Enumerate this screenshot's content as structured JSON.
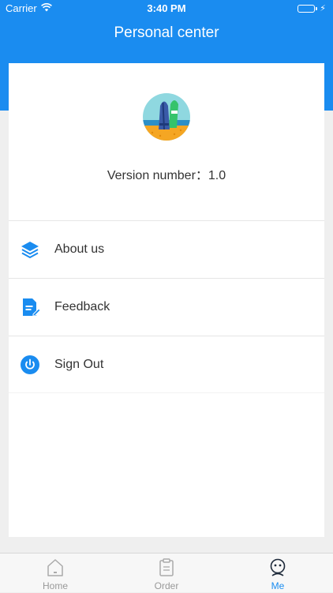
{
  "status_bar": {
    "carrier": "Carrier",
    "time": "3:40 PM"
  },
  "header": {
    "title": "Personal center",
    "background_color": "#1a8cf0"
  },
  "profile": {
    "logo_icon": "surfboard-beach-icon",
    "version_text": "Version number：1.0"
  },
  "menu": {
    "items": [
      {
        "label": "About us",
        "icon": "layers-icon"
      },
      {
        "label": "Feedback",
        "icon": "document-edit-icon"
      },
      {
        "label": "Sign Out",
        "icon": "power-icon"
      }
    ]
  },
  "tabbar": {
    "tabs": [
      {
        "label": "Home",
        "icon": "home-icon",
        "active": false
      },
      {
        "label": "Order",
        "icon": "clipboard-icon",
        "active": false
      },
      {
        "label": "Me",
        "icon": "face-icon",
        "active": true
      }
    ],
    "active_color": "#1a8cf0",
    "inactive_color": "#999999"
  }
}
